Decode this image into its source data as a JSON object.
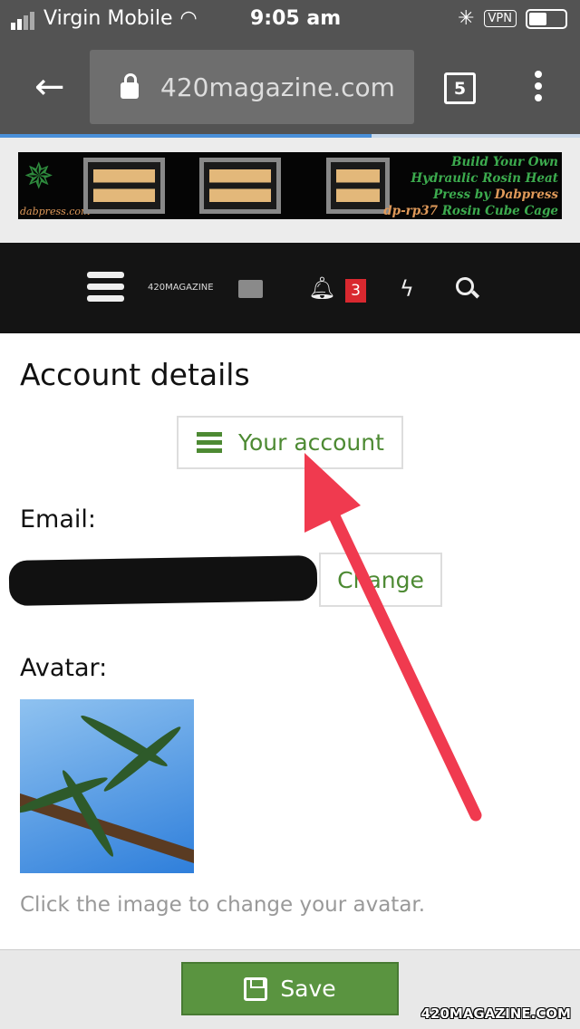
{
  "status_bar": {
    "carrier": "Virgin Mobile",
    "time": "9:05 am",
    "vpn": "VPN",
    "battery_level": 0.5
  },
  "browser": {
    "url": "420magazine.com",
    "tab_count": "5",
    "load_progress": 0.64
  },
  "ad": {
    "site": "dabpress.com",
    "line1": "Build Your Own",
    "line2": "Hydraulic Rosin Heat",
    "line3a": "Press by ",
    "line3b": "Dabpress",
    "line4a": "dp-rp37",
    "line4b": " Rosin Cube Cage"
  },
  "nav": {
    "logo": "420MAGAZINE",
    "notification_count": "3"
  },
  "page": {
    "title": "Account details",
    "your_account": "Your account",
    "email_label": "Email:",
    "change": "Change",
    "avatar_label": "Avatar:",
    "avatar_hint": "Click the image to change your avatar."
  },
  "footer": {
    "save": "Save",
    "watermark": "420MAGAZINE.COM"
  },
  "colors": {
    "accent": "#4d8a33",
    "badge": "#d9282f",
    "arrow": "#f03a4f"
  }
}
